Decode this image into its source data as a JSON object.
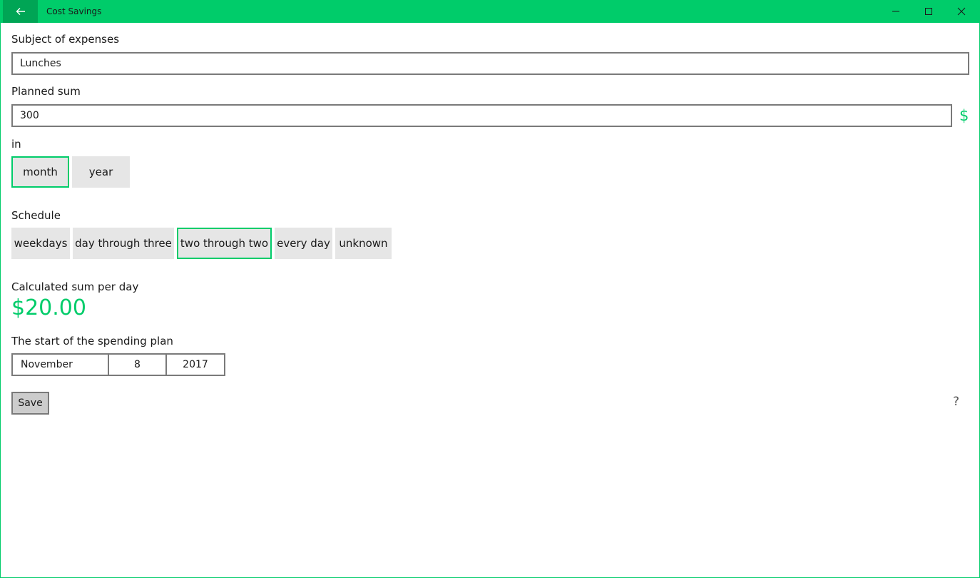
{
  "window": {
    "title": "Cost Savings"
  },
  "form": {
    "subject_label": "Subject of expenses",
    "subject_value": "Lunches",
    "planned_label": "Planned sum",
    "planned_value": "300",
    "currency_symbol": "$",
    "period_label": "in",
    "period_options": [
      "month",
      "year"
    ],
    "period_selected": "month",
    "schedule_label": "Schedule",
    "schedule_options": [
      "weekdays",
      "day through three",
      "two through two",
      "every day",
      "unknown"
    ],
    "schedule_selected": "two through two",
    "calc_label": "Calculated sum per day",
    "calc_value": "$20.00",
    "start_label": "The start of the spending plan",
    "start_month": "November",
    "start_day": "8",
    "start_year": "2017",
    "save_label": "Save",
    "help_symbol": "?"
  },
  "colors": {
    "accent": "#00cc6a",
    "accent_dark": "#00a555",
    "toggle_bg": "#e6e6e6",
    "border": "#7a7a7a"
  },
  "icons": {
    "back": "back-arrow-icon",
    "minimize": "minimize-icon",
    "maximize": "maximize-icon",
    "close": "close-icon",
    "help": "help-icon"
  }
}
